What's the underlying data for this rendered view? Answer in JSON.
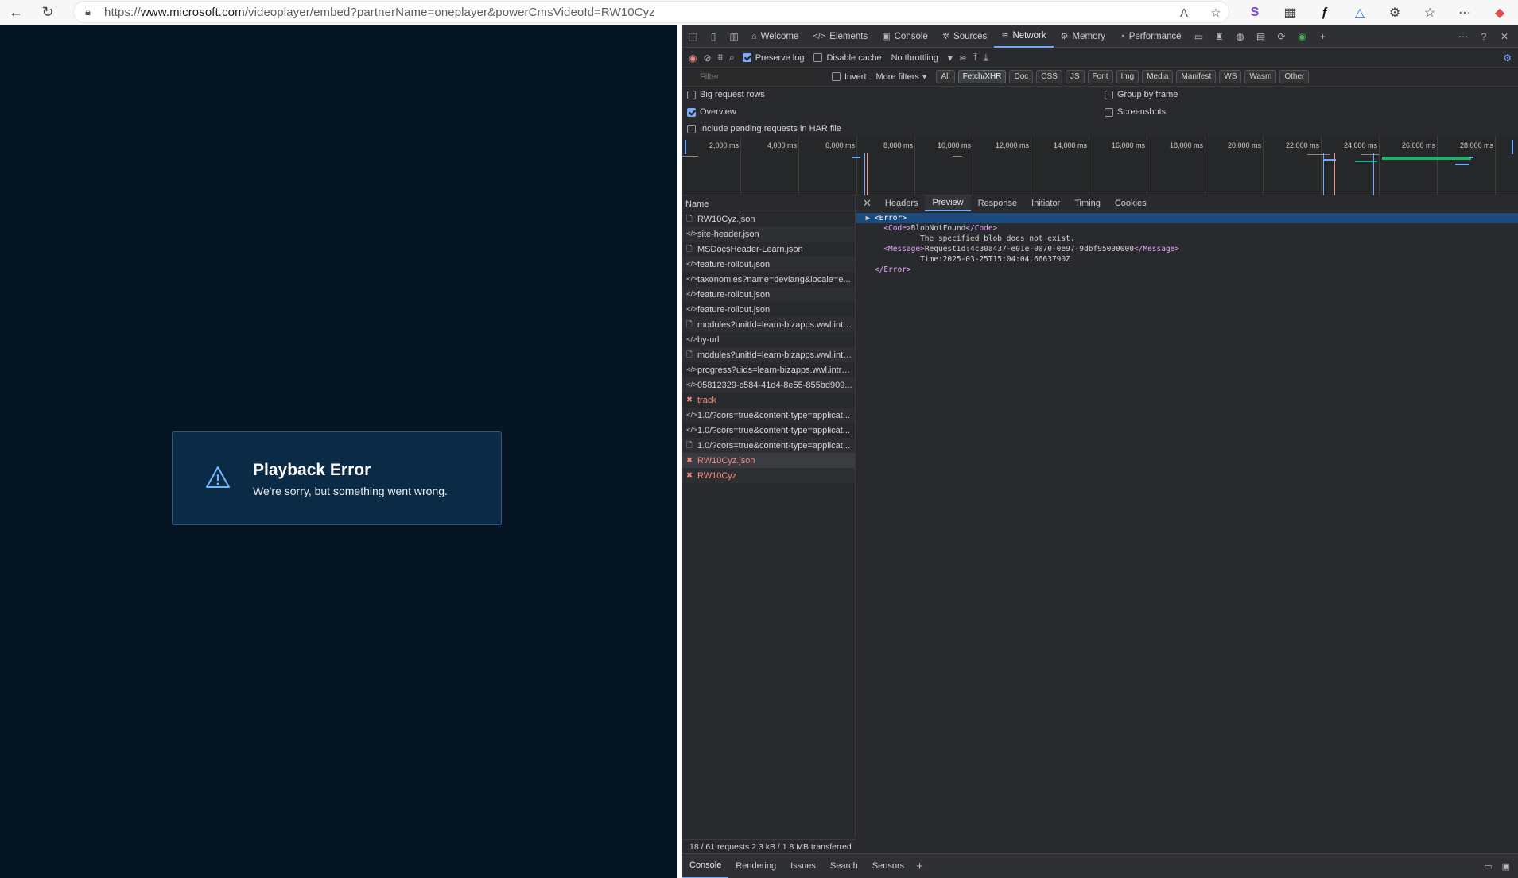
{
  "browser": {
    "url_scheme": "https://",
    "url_host": "www.microsoft.com",
    "url_path": "/videoplayer/embed?partnerName=oneplayer&powerCmsVideoId=RW10Cyz"
  },
  "player": {
    "error_title": "Playback Error",
    "error_message": "We're sorry, but something went wrong."
  },
  "devtools": {
    "tabs": [
      {
        "label": "Welcome"
      },
      {
        "label": "Elements"
      },
      {
        "label": "Console"
      },
      {
        "label": "Sources"
      },
      {
        "label": "Network"
      },
      {
        "label": "Memory"
      },
      {
        "label": "Performance"
      }
    ],
    "toolbar": {
      "preserve_log": "Preserve log",
      "disable_cache": "Disable cache",
      "throttling": "No throttling"
    },
    "filter": {
      "placeholder": "Filter",
      "invert": "Invert",
      "more_filters": "More filters",
      "types": [
        "All",
        "Fetch/XHR",
        "Doc",
        "CSS",
        "JS",
        "Font",
        "Img",
        "Media",
        "Manifest",
        "WS",
        "Wasm",
        "Other"
      ]
    },
    "options": {
      "big_rows": "Big request rows",
      "overview": "Overview",
      "har": "Include pending requests in HAR file",
      "group_by_frame": "Group by frame",
      "screenshots": "Screenshots"
    },
    "timeline_ticks": [
      "2,000 ms",
      "4,000 ms",
      "6,000 ms",
      "8,000 ms",
      "10,000 ms",
      "12,000 ms",
      "14,000 ms",
      "16,000 ms",
      "18,000 ms",
      "20,000 ms",
      "22,000 ms",
      "24,000 ms",
      "26,000 ms",
      "28,000 ms"
    ],
    "name_header": "Name",
    "requests": [
      {
        "name": "RW10Cyz.json",
        "type": "doc"
      },
      {
        "name": "site-header.json",
        "type": "xhr"
      },
      {
        "name": "MSDocsHeader-Learn.json",
        "type": "doc"
      },
      {
        "name": "feature-rollout.json",
        "type": "xhr"
      },
      {
        "name": "taxonomies?name=devlang&locale=e...",
        "type": "xhr"
      },
      {
        "name": "feature-rollout.json",
        "type": "xhr"
      },
      {
        "name": "feature-rollout.json",
        "type": "xhr"
      },
      {
        "name": "modules?unitId=learn-bizapps.wwl.intr...",
        "type": "doc"
      },
      {
        "name": "by-url",
        "type": "xhr"
      },
      {
        "name": "modules?unitId=learn-bizapps.wwl.intr...",
        "type": "doc"
      },
      {
        "name": "progress?uids=learn-bizapps.wwl.intro...",
        "type": "xhr"
      },
      {
        "name": "05812329-c584-41d4-8e55-855bd909...",
        "type": "xhr"
      },
      {
        "name": "track",
        "type": "error"
      },
      {
        "name": "1.0/?cors=true&content-type=applicat...",
        "type": "xhr"
      },
      {
        "name": "1.0/?cors=true&content-type=applicat...",
        "type": "xhr"
      },
      {
        "name": "1.0/?cors=true&content-type=applicat...",
        "type": "doc"
      },
      {
        "name": "RW10Cyz.json",
        "type": "error",
        "selected": true
      },
      {
        "name": "RW10Cyz",
        "type": "error"
      }
    ],
    "status": "18 / 61 requests   2.3 kB / 1.8 MB transferred",
    "detail_tabs": [
      "Headers",
      "Preview",
      "Response",
      "Initiator",
      "Timing",
      "Cookies"
    ],
    "active_detail_tab": "Preview",
    "preview": {
      "l1": "<Error>",
      "code_open": "<Code>",
      "code": "BlobNotFound",
      "code_close": "</Code>",
      "l3": "The specified blob does not exist.",
      "msg_open": "<Message>",
      "msg": "RequestId:4c30a437-e01e-0070-0e97-9dbf95000000",
      "msg_close": "</Message>",
      "l5": "Time:2025-03-25T15:04:04.6663790Z",
      "l6": "</Error>"
    },
    "drawer_tabs": [
      "Console",
      "Rendering",
      "Issues",
      "Search",
      "Sensors"
    ]
  },
  "colors": {
    "player_bg": "#051423",
    "error_box": "#0b2a45",
    "devtools_bg": "#292a2d",
    "accent": "#6fa8ff",
    "error_text": "#f28b82"
  }
}
